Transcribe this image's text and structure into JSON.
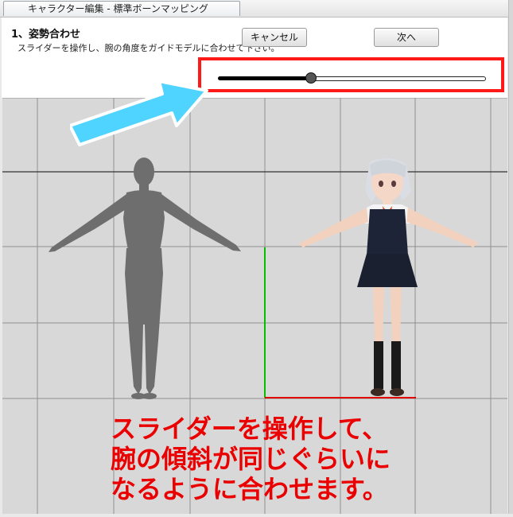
{
  "window": {
    "tab_title": "キャラクター編集 - 標準ボーンマッピング"
  },
  "header": {
    "step_title": "1、姿勢合わせ",
    "step_description": "スライダーを操作し、腕の角度をガイドモデルに合わせて下さい。",
    "cancel_label": "キャンセル",
    "next_label": "次へ"
  },
  "slider": {
    "value_fraction": 0.35
  },
  "colors": {
    "highlight": "#ff1a1a",
    "annotation": "#ea0000",
    "arrow": "#4fd3ff",
    "axis_green": "#00c000",
    "axis_red": "#e00000"
  },
  "annotation": {
    "line1": "スライダーを操作して、",
    "line2": "腕の傾斜が同じぐらいに",
    "line3": "なるように合わせます。"
  }
}
